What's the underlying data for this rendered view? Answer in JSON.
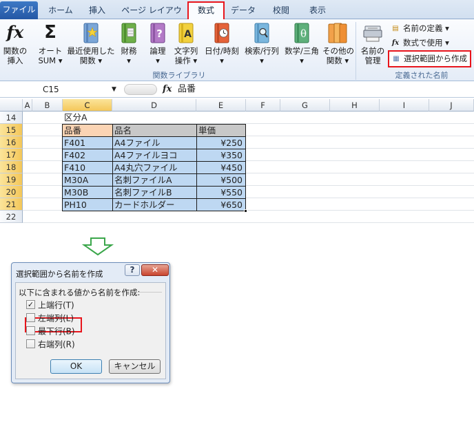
{
  "ribbon_tabs": [
    "ファイル",
    "ホーム",
    "挿入",
    "ページ レイアウト",
    "数式",
    "データ",
    "校閲",
    "表示"
  ],
  "ribbon": {
    "insert_function": [
      "関数の",
      "挿入"
    ],
    "autosum": [
      "オート",
      "SUM ▾"
    ],
    "recent": [
      "最近使用した",
      "関数 ▾"
    ],
    "financial": [
      "財務",
      "▾"
    ],
    "logical": [
      "論理",
      "▾"
    ],
    "text": [
      "文字列",
      "操作 ▾"
    ],
    "datetime": [
      "日付/時刻",
      "▾"
    ],
    "lookup": [
      "検索/行列",
      "▾"
    ],
    "math": [
      "数学/三角",
      "▾"
    ],
    "more": [
      "その他の",
      "関数 ▾"
    ],
    "function_library_label": "関数ライブラリ",
    "name_manager": [
      "名前の",
      "管理"
    ],
    "define_name": "名前の定義 ▾",
    "use_in_formula": "数式で使用 ▾",
    "create_from_selection": "選択範囲から作成",
    "defined_names_label": "定義された名前"
  },
  "formula_bar": {
    "name_box": "C15",
    "fx": "fx",
    "value": "品番"
  },
  "sheet": {
    "columns": [
      "A",
      "B",
      "C",
      "D",
      "E",
      "F",
      "G",
      "H",
      "I",
      "J"
    ],
    "rows": [
      "14",
      "15",
      "16",
      "17",
      "18",
      "19",
      "20",
      "21",
      "22"
    ],
    "caption": "区分A",
    "headers": [
      "品番",
      "品名",
      "単価"
    ],
    "data": [
      [
        "F401",
        "A4ファイル",
        "¥250"
      ],
      [
        "F402",
        "A4ファイルヨコ",
        "¥350"
      ],
      [
        "F410",
        "A4丸穴ファイル",
        "¥450"
      ],
      [
        "M30A",
        "名刺ファイルA",
        "¥500"
      ],
      [
        "M30B",
        "名刺ファイルB",
        "¥550"
      ],
      [
        "PH10",
        "カードホルダー",
        "¥650"
      ]
    ]
  },
  "dialog": {
    "title": "選択範囲から名前を作成",
    "help": "?",
    "close": "✕",
    "section": "以下に含まれる値から名前を作成:",
    "options": [
      {
        "label": "上端行(T)",
        "checked": true
      },
      {
        "label": "左端列(L)",
        "checked": false
      },
      {
        "label": "最下行(B)",
        "checked": false
      },
      {
        "label": "右端列(R)",
        "checked": false
      }
    ],
    "ok": "OK",
    "cancel": "キャンセル"
  },
  "colors": {
    "highlight": "#e8141b",
    "table_fill": "#bed8f2",
    "header_fill": "#c8c8c8",
    "active_cell": "#fbd4b4",
    "arrow": "#3aa64a"
  }
}
